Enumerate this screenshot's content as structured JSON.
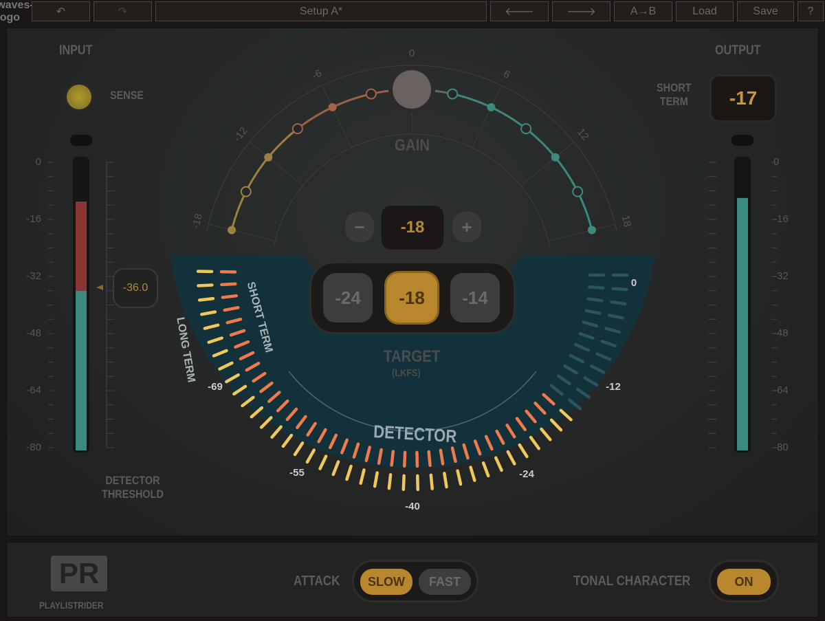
{
  "toolbar": {
    "logo": "waves-logo",
    "undo": "↶",
    "redo": "↷",
    "preset": "Setup A*",
    "prev": "🡐",
    "next": "🡒",
    "ab": "A→B",
    "load": "Load",
    "save": "Save",
    "help": "?"
  },
  "input": {
    "title": "INPUT",
    "sense_label": "SENSE",
    "scale": [
      "0",
      "-16",
      "-32",
      "-48",
      "-64",
      "-80"
    ],
    "level_db": -11,
    "threshold_value": "-36.0",
    "threshold_label_1": "DETECTOR",
    "threshold_label_2": "THRESHOLD"
  },
  "output": {
    "title": "OUTPUT",
    "short_term_label_1": "SHORT",
    "short_term_label_2": "TERM",
    "short_term_value": "-17",
    "scale": [
      "0",
      "-16",
      "-32",
      "-48",
      "-64",
      "-80"
    ],
    "level_db": -10
  },
  "gain": {
    "label": "GAIN",
    "ticks": [
      "-18",
      "-12",
      "-6",
      "0",
      "6",
      "12",
      "18"
    ],
    "value_db": 0,
    "target_value": "-18",
    "minus": "−",
    "plus": "+"
  },
  "target": {
    "label": "TARGET",
    "unit": "(LKFS)",
    "options": [
      "-24",
      "-18",
      "-14"
    ],
    "selected": "-18"
  },
  "detector": {
    "label": "DETECTOR",
    "long_term": "LONG TERM",
    "short_term": "SHORT TERM",
    "scale": [
      "-69",
      "-55",
      "-40",
      "-24",
      "-12",
      "0"
    ]
  },
  "bottom": {
    "product": "PLAYLISTRIDER",
    "attack_label": "ATTACK",
    "attack_options": [
      "SLOW",
      "FAST"
    ],
    "attack_selected": "SLOW",
    "tonal_label": "TONAL CHARACTER",
    "tonal_value": "ON"
  },
  "colors": {
    "accent": "#c9973a",
    "teal": "#3a8a80",
    "detector_bg": "#12313a",
    "long_term": "#f0c85a",
    "short_term": "#f07a4a"
  }
}
